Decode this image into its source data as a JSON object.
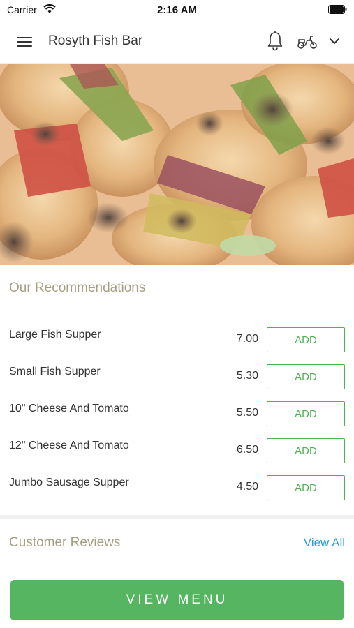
{
  "status_bar": {
    "carrier": "Carrier",
    "time": "2:16 AM"
  },
  "header": {
    "title": "Rosyth Fish Bar"
  },
  "icons": {
    "menu": "menu-icon",
    "notifications": "bell-icon",
    "delivery": "scooter-icon",
    "dropdown": "chevron-down-icon",
    "wifi": "wifi-icon",
    "battery": "battery-icon"
  },
  "recommendations": {
    "title": "Our Recommendations",
    "items": [
      {
        "name": "Large Fish Supper",
        "price": "7.00",
        "action": "ADD"
      },
      {
        "name": "Small Fish Supper",
        "price": "5.30",
        "action": "ADD"
      },
      {
        "name": "10\" Cheese And Tomato",
        "price": "5.50",
        "action": "ADD"
      },
      {
        "name": "12\" Cheese And Tomato",
        "price": "6.50",
        "action": "ADD"
      },
      {
        "name": "Jumbo Sausage Supper",
        "price": "4.50",
        "action": "ADD"
      }
    ]
  },
  "reviews": {
    "title": "Customer Reviews",
    "view_all": "View All"
  },
  "footer": {
    "view_menu": "VIEW MENU"
  },
  "colors": {
    "accent_green": "#4caf50",
    "button_green": "#55b560",
    "section_title": "#a59f82",
    "link_blue": "#2a9fd6"
  }
}
